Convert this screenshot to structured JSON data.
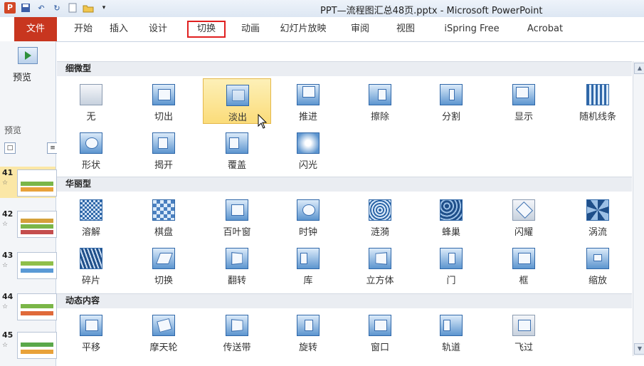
{
  "window": {
    "title": "PPT—流程图汇总48页.pptx - Microsoft PowerPoint"
  },
  "menu": {
    "file": "文件",
    "tabs": [
      "开始",
      "插入",
      "设计",
      "切换",
      "动画",
      "幻灯片放映",
      "审阅",
      "视图",
      "iSpring Free",
      "Acrobat"
    ],
    "highlighted_tab": "切换"
  },
  "ribbon": {
    "preview_label": "预览",
    "group_label": "预览"
  },
  "slides": [
    {
      "num": "41",
      "star": "☆"
    },
    {
      "num": "42",
      "star": "☆"
    },
    {
      "num": "43",
      "star": "☆"
    },
    {
      "num": "44",
      "star": "☆"
    },
    {
      "num": "45",
      "star": "☆"
    }
  ],
  "gallery": {
    "sections": [
      {
        "title": "细微型",
        "items": [
          "无",
          "切出",
          "淡出",
          "推进",
          "擦除",
          "分割",
          "显示",
          "随机线条",
          "形状",
          "揭开",
          "覆盖",
          "闪光"
        ]
      },
      {
        "title": "华丽型",
        "items": [
          "溶解",
          "棋盘",
          "百叶窗",
          "时钟",
          "涟漪",
          "蜂巢",
          "闪耀",
          "涡流",
          "碎片",
          "切换",
          "翻转",
          "库",
          "立方体",
          "门",
          "框",
          "缩放"
        ]
      },
      {
        "title": "动态内容",
        "items": [
          "平移",
          "摩天轮",
          "传送带",
          "旋转",
          "窗口",
          "轨道",
          "飞过"
        ]
      }
    ],
    "selected": "淡出"
  },
  "colors": {
    "file_tab": "#c8361f",
    "highlight_border": "#e02020",
    "selected_fill": "#fbdc7a"
  }
}
